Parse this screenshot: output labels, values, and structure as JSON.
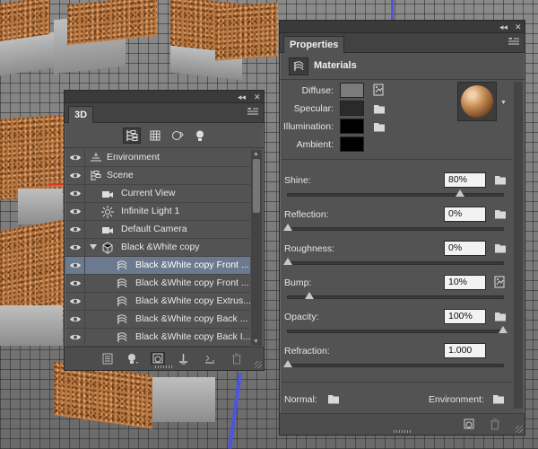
{
  "panel3d": {
    "tab_label": "3D",
    "collapse_icon": "◂◂",
    "close_icon": "✕",
    "menu_icon": "≡",
    "filter_buttons": [
      "scene-filter-icon",
      "mesh-filter-icon",
      "material-filter-icon",
      "light-filter-icon"
    ],
    "layers": [
      {
        "label": "Environment",
        "icon": "environment-icon",
        "indent": 0
      },
      {
        "label": "Scene",
        "icon": "scene-icon",
        "indent": 0
      },
      {
        "label": "Current View",
        "icon": "camera-icon",
        "indent": 1
      },
      {
        "label": "Infinite Light 1",
        "icon": "light-icon",
        "indent": 1
      },
      {
        "label": "Default Camera",
        "icon": "camera-icon",
        "indent": 1
      },
      {
        "label": "Black &White copy",
        "icon": "mesh-icon",
        "indent": 1,
        "expanded": true
      },
      {
        "label": "Black &White copy Front ...",
        "icon": "material-icon",
        "indent": 2,
        "selected": true
      },
      {
        "label": "Black &White copy Front ...",
        "icon": "material-icon",
        "indent": 2
      },
      {
        "label": "Black &White copy Extrus...",
        "icon": "material-icon",
        "indent": 2
      },
      {
        "label": "Black &White copy Back ...",
        "icon": "material-icon",
        "indent": 2
      },
      {
        "label": "Black &White copy Back I...",
        "icon": "material-icon",
        "indent": 2
      }
    ],
    "bottom_buttons": [
      "render-icon",
      "light-add-icon",
      "material-drop-icon",
      "ground-icon",
      "delete-icon"
    ]
  },
  "properties": {
    "tab_label": "Properties",
    "section_title": "Materials",
    "swatches": {
      "diffuse_label": "Diffuse:",
      "specular_label": "Specular:",
      "illumination_label": "Illumination:",
      "ambient_label": "Ambient:",
      "diffuse_color": "#7b7b7b",
      "specular_color": "#2a2a2a",
      "illumination_color": "#000000",
      "ambient_color": "#000000"
    },
    "sliders": [
      {
        "label": "Shine:",
        "value": "80%",
        "fraction": 0.8
      },
      {
        "label": "Reflection:",
        "value": "0%",
        "fraction": 0.0
      },
      {
        "label": "Roughness:",
        "value": "0%",
        "fraction": 0.0
      },
      {
        "label": "Bump:",
        "value": "10%",
        "fraction": 0.1
      },
      {
        "label": "Opacity:",
        "value": "100%",
        "fraction": 1.0
      },
      {
        "label": "Refraction:",
        "value": "1.000",
        "fraction": 0.0
      }
    ],
    "normal_label": "Normal:",
    "environment_label": "Environment:"
  },
  "colors": {
    "panel_bg": "#535353",
    "selected_row": "#6b7a8f",
    "scene_blue_axis": "#4a55e0",
    "cork": "#b9773f"
  }
}
